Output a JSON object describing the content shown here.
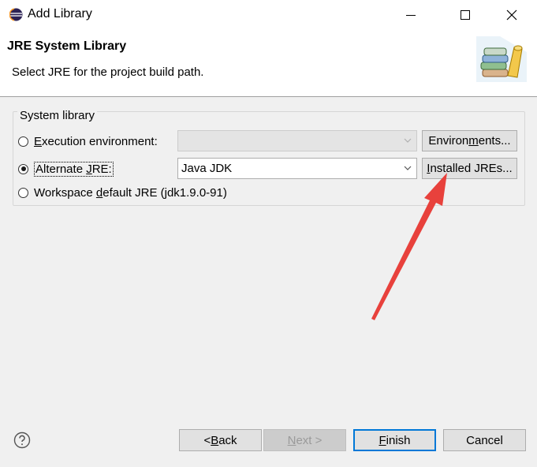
{
  "window": {
    "title": "Add Library",
    "icon": "eclipse-icon"
  },
  "header": {
    "title": "JRE System Library",
    "description": "Select JRE for the project build path.",
    "image": "books-icon"
  },
  "group": {
    "legend": "System library",
    "options": [
      {
        "label_pre": "",
        "mnemonic": "E",
        "label_post": "xecution environment:",
        "checked": false,
        "enabled": true
      },
      {
        "label_pre": "Alternate ",
        "mnemonic": "J",
        "label_post": "RE:",
        "checked": true,
        "enabled": true
      },
      {
        "label_pre": "Workspace ",
        "mnemonic": "d",
        "label_post": "efault JRE (jdk1.9.0-91)",
        "checked": false,
        "enabled": true
      }
    ],
    "exec_combo": {
      "value": "",
      "enabled": false
    },
    "alt_combo": {
      "value": "Java JDK",
      "enabled": true
    },
    "env_button": {
      "pre": "Environ",
      "mnemonic": "m",
      "post": "ents..."
    },
    "installed_button": {
      "pre": "",
      "mnemonic": "I",
      "post": "nstalled JREs..."
    }
  },
  "footer": {
    "back": {
      "pre": "< ",
      "mnemonic": "B",
      "post": "ack",
      "enabled": true
    },
    "next": {
      "pre": "",
      "mnemonic": "N",
      "post": "ext >",
      "enabled": false
    },
    "finish": {
      "pre": "",
      "mnemonic": "F",
      "post": "inish",
      "enabled": true,
      "default": true
    },
    "cancel": {
      "label": "Cancel",
      "enabled": true
    },
    "help_icon": "help-icon"
  },
  "colors": {
    "annotation_arrow": "#e8413c",
    "default_button_border": "#0078d7"
  }
}
